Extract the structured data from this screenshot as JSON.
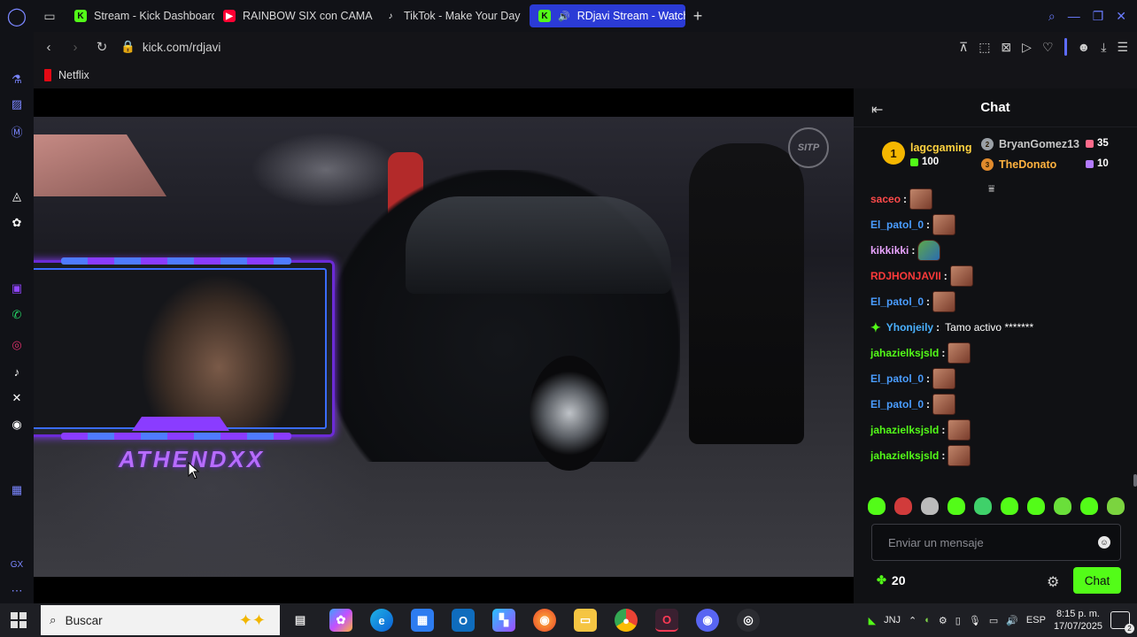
{
  "tabs": [
    {
      "label": "Stream - Kick Dashboard",
      "icon": "kick-icon",
      "color": "#53fc18"
    },
    {
      "label": "RAINBOW SIX con CAMA",
      "icon": "youtube-icon",
      "color": "#ff0033"
    },
    {
      "label": "TikTok - Make Your Day",
      "icon": "tiktok-icon",
      "color": "#ffffff"
    },
    {
      "label": "RDjavi Stream - Watch",
      "icon": "kick-icon",
      "color": "#53fc18",
      "active": true
    }
  ],
  "address": {
    "url": "kick.com/rdjavi"
  },
  "bookmarks": [
    {
      "label": "Netflix"
    }
  ],
  "video": {
    "overlay_name": "ATHENDXX",
    "watermark": "SITP"
  },
  "chat": {
    "title": "Chat",
    "leaderboard": [
      {
        "rank": "1",
        "name": "lagcgaming",
        "count": "100",
        "name_color": "#ffd23f"
      },
      {
        "rank": "2",
        "name": "BryanGomez13",
        "count": "35",
        "name_color": "#c7c7c7"
      },
      {
        "rank": "3",
        "name": "TheDonato",
        "count": "10",
        "name_color": "#ffb23f"
      }
    ],
    "messages": [
      {
        "user": "saceo",
        "color": "#ff4a4a",
        "text": "",
        "emote": "emote"
      },
      {
        "user": "El_patol_0",
        "color": "#4a9dff",
        "text": "",
        "emote": "emote"
      },
      {
        "user": "kikkikki",
        "color": "#e9a4ff",
        "text": "",
        "emote": "frog"
      },
      {
        "user": "RDJHONJAVII",
        "color": "#ff3a3a",
        "text": "",
        "emote": "emote"
      },
      {
        "user": "El_patol_0",
        "color": "#4a9dff",
        "text": "",
        "emote": "emote"
      },
      {
        "user": "Yhonjeily",
        "color": "#4ab1ff",
        "text": "Tamo activo *******",
        "emote": "",
        "badge": true
      },
      {
        "user": "jahazielksjsld",
        "color": "#53fc18",
        "text": "",
        "emote": "emote"
      },
      {
        "user": "El_patol_0",
        "color": "#4a9dff",
        "text": "",
        "emote": "emote"
      },
      {
        "user": "El_patol_0",
        "color": "#4a9dff",
        "text": "",
        "emote": "emote"
      },
      {
        "user": "jahazielksjsld",
        "color": "#53fc18",
        "text": "",
        "emote": "emote"
      },
      {
        "user": "jahazielksjsld",
        "color": "#53fc18",
        "text": "",
        "emote": "emote"
      }
    ],
    "input_placeholder": "Enviar un mensaje",
    "points": "20",
    "send_label": "Chat"
  },
  "taskbar": {
    "search_placeholder": "Buscar",
    "tray_lang_primary": "JNJ",
    "tray_lang": "ESP",
    "time": "8:15 p. m.",
    "date": "17/07/2025",
    "notifications": "2"
  }
}
